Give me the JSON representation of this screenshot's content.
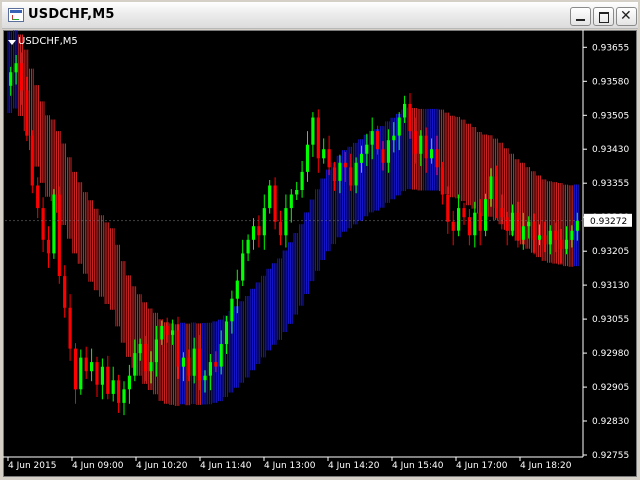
{
  "window": {
    "title": "USDCHF,M5"
  },
  "chart": {
    "symbol_label": "USDCHF,M5",
    "current_price": "0.93272"
  },
  "colors": {
    "bull": "#00ff00",
    "bear": "#ff0000",
    "band_up": "#ff2a2a",
    "band_down": "#1a1aff",
    "background": "#000000",
    "axis": "#ffffff"
  },
  "icons": {
    "minimize": "minimize-icon",
    "maximize": "maximize-icon",
    "close": "close-icon",
    "app": "chart-window-icon",
    "collapse": "triangle-down-icon"
  },
  "chart_data": {
    "type": "candlestick",
    "title": "USDCHF,M5",
    "y_ticks": [
      "0.93655",
      "0.93580",
      "0.93505",
      "0.93430",
      "0.93355",
      "0.93280",
      "0.93205",
      "0.93130",
      "0.93055",
      "0.92980",
      "0.92905",
      "0.92830",
      "0.92755"
    ],
    "x_ticks": [
      "4 Jun 2015",
      "4 Jun 09:00",
      "4 Jun 10:20",
      "4 Jun 11:40",
      "4 Jun 13:00",
      "4 Jun 14:20",
      "4 Jun 15:40",
      "4 Jun 17:00",
      "4 Jun 18:20"
    ],
    "ylim": [
      0.92755,
      0.9368
    ],
    "grid": false,
    "current_price": 0.93272,
    "close": [
      0.936,
      0.9362,
      0.9356,
      0.9346,
      0.9335,
      0.933,
      0.9323,
      0.932,
      0.9333,
      0.9315,
      0.9308,
      0.9299,
      0.929,
      0.9297,
      0.9294,
      0.9296,
      0.9291,
      0.9295,
      0.9289,
      0.9292,
      0.9287,
      0.929,
      0.9293,
      0.9298,
      0.93,
      0.9294,
      0.9296,
      0.9301,
      0.9304,
      0.9302,
      0.9303,
      0.9295,
      0.9297,
      0.9293,
      0.9299,
      0.9292,
      0.9293,
      0.9296,
      0.9295,
      0.93,
      0.9305,
      0.931,
      0.9314,
      0.932,
      0.9323,
      0.9326,
      0.9324,
      0.933,
      0.9335,
      0.9327,
      0.9324,
      0.933,
      0.9333,
      0.9334,
      0.9338,
      0.9344,
      0.935,
      0.9341,
      0.9343,
      0.9339,
      0.9336,
      0.934,
      0.9339,
      0.9335,
      0.934,
      0.9342,
      0.9344,
      0.9347,
      0.9343,
      0.934,
      0.9345,
      0.9346,
      0.935,
      0.9353,
      0.9347,
      0.9342,
      0.9346,
      0.9341,
      0.9343,
      0.9339,
      0.9333,
      0.9327,
      0.9325,
      0.933,
      0.9328,
      0.9324,
      0.9329,
      0.9325,
      0.9332,
      0.9337,
      0.933,
      0.9328,
      0.9325,
      0.9329,
      0.9323,
      0.9326,
      0.9327,
      0.9323,
      0.9324,
      0.9322,
      0.9325,
      0.9323,
      0.9321,
      0.9323,
      0.9325,
      0.93272
    ]
  }
}
